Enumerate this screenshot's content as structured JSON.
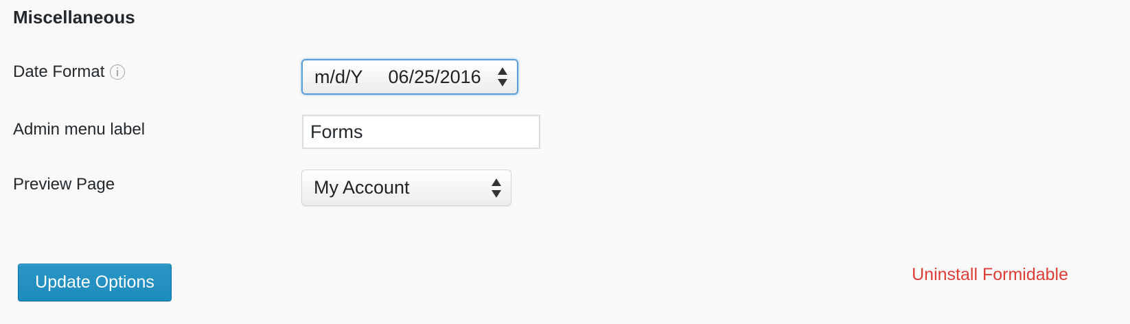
{
  "section": {
    "title": "Miscellaneous"
  },
  "date_format": {
    "label": "Date Format",
    "selected_value": "m/d/Y     06/25/2016"
  },
  "admin_menu_label": {
    "label": "Admin menu label",
    "value": "Forms"
  },
  "preview_page": {
    "label": "Preview Page",
    "selected_value": "My Account"
  },
  "actions": {
    "update_label": "Update Options",
    "uninstall_label": "Uninstall Formidable"
  },
  "icons": {
    "info": "info-icon",
    "select_arrows": "updown-arrows-icon"
  },
  "colors": {
    "primary_button": "#1e8cbe",
    "danger_link": "#dd3d36",
    "focus_border": "#5b9dd9",
    "background": "#f9f9f9"
  }
}
